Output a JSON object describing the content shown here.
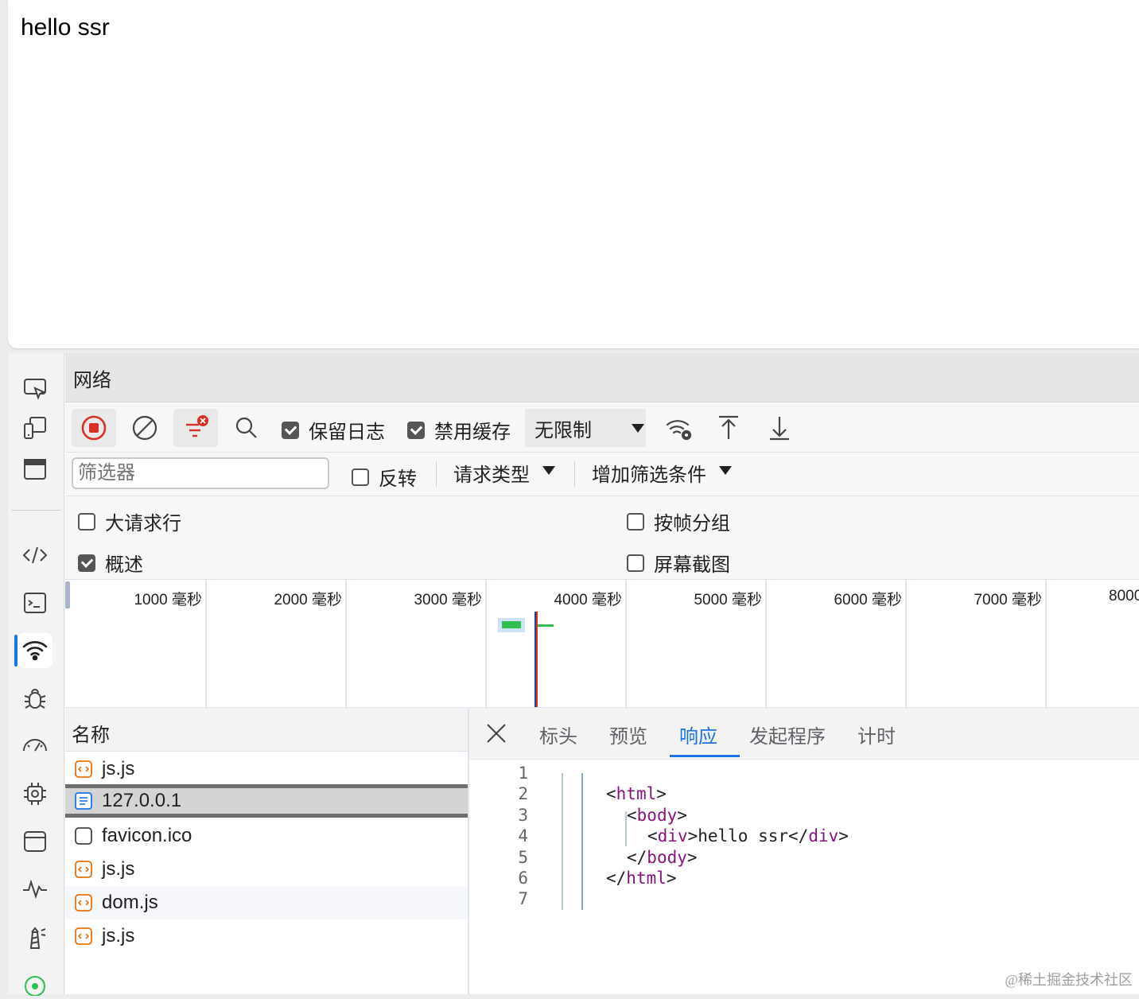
{
  "page": {
    "content_text": "hello ssr"
  },
  "activity_bar": {
    "items": [
      "inspect-icon",
      "device-icon",
      "window-icon",
      "elements-icon",
      "console-icon",
      "network-icon",
      "bug-icon",
      "performance-icon",
      "memory-chip-icon",
      "application-icon",
      "activity-icon",
      "lighthouse-icon",
      "more-icon"
    ],
    "active": "network-icon"
  },
  "panel": {
    "title": "网络"
  },
  "toolbar": {
    "preserve_log": {
      "label": "保留日志",
      "checked": true
    },
    "disable_cache": {
      "label": "禁用缓存",
      "checked": true
    },
    "throttle": "无限制"
  },
  "filter": {
    "placeholder": "筛选器",
    "invert": {
      "label": "反转",
      "checked": false
    },
    "request_types": "请求类型",
    "add_filter": "增加筛选条件"
  },
  "options": {
    "big_rows": {
      "label": "大请求行",
      "checked": false
    },
    "group_by_frame": {
      "label": "按帧分组",
      "checked": false
    },
    "overview": {
      "label": "概述",
      "checked": true
    },
    "screenshots": {
      "label": "屏幕截图",
      "checked": false
    }
  },
  "timeline": {
    "ticks": [
      "1000  毫秒",
      "2000  毫秒",
      "3000  毫秒",
      "4000  毫秒",
      "5000  毫秒",
      "6000  毫秒",
      "7000  毫秒",
      "8000"
    ]
  },
  "requests": {
    "header": "名称",
    "rows": [
      {
        "name": "js.js",
        "type": "script"
      },
      {
        "name": "127.0.0.1",
        "type": "document"
      },
      {
        "name": "favicon.ico",
        "type": "other"
      },
      {
        "name": "js.js",
        "type": "script"
      },
      {
        "name": "dom.js",
        "type": "script"
      },
      {
        "name": "js.js",
        "type": "script"
      }
    ],
    "selected": 1
  },
  "detail": {
    "tabs": [
      "标头",
      "预览",
      "响应",
      "发起程序",
      "计时"
    ],
    "active_tab": "响应",
    "line_numbers": [
      "1",
      "2",
      "3",
      "4",
      "5",
      "6",
      "7"
    ],
    "code": {
      "l2": {
        "open": "<",
        "tag": "html",
        "close": ">"
      },
      "l3": {
        "open": "<",
        "tag": "body",
        "close": ">"
      },
      "l4": {
        "open": "<",
        "tag": "div",
        "mid": ">hello ssr</",
        "tag2": "div",
        "close": ">"
      },
      "l5": {
        "open": "</",
        "tag": "body",
        "close": ">"
      },
      "l6": {
        "open": "</",
        "tag": "html",
        "close": ">"
      }
    }
  },
  "colors": {
    "accent": "#1a73e8",
    "record": "#d93025",
    "tag": "#881280",
    "timing_bar": "#2fbf4f"
  },
  "watermark": "@稀土掘金技术社区"
}
